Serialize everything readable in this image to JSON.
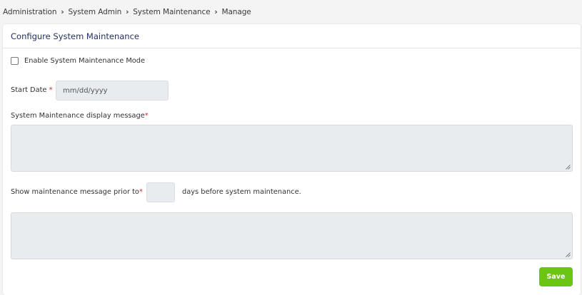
{
  "breadcrumb": {
    "items": [
      "Administration",
      "System Admin",
      "System Maintenance",
      "Manage"
    ],
    "separator": "›"
  },
  "card": {
    "title": "Configure System Maintenance"
  },
  "form": {
    "enable_mode_label": "Enable System Maintenance Mode",
    "enable_mode_checked": false,
    "start_date_label": "Start Date",
    "start_date_placeholder": "mm/dd/yyyy",
    "required_mark": "*",
    "display_message_label": "System Maintenance display message",
    "display_message_value": "",
    "prior_label": "Show maintenance message prior to",
    "prior_days_value": "",
    "prior_suffix": "days before system maintenance.",
    "second_message_value": "",
    "save_label": "Save"
  },
  "colors": {
    "accent_green": "#6cc413",
    "title_navy": "#1f2d5c",
    "required_red": "#d9262a",
    "input_bg": "#e9ecef"
  }
}
